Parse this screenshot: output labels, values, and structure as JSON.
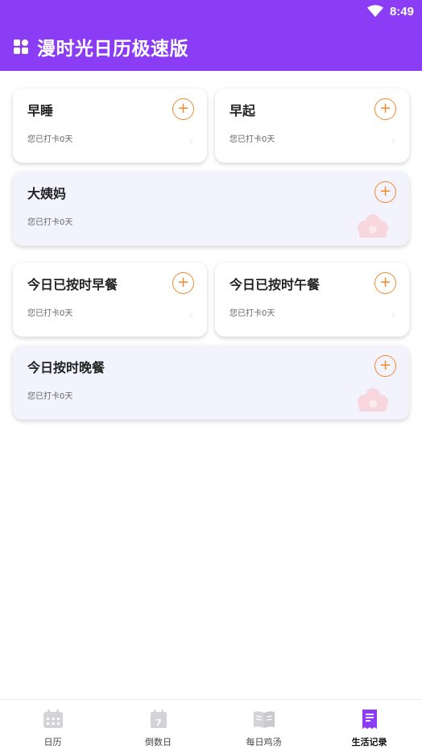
{
  "status": {
    "time": "8:49"
  },
  "app": {
    "title": "漫时光日历极速版"
  },
  "cards": [
    {
      "title": "早睡",
      "sub": "您已打卡0天",
      "add": "+"
    },
    {
      "title": "早起",
      "sub": "您已打卡0天",
      "add": "+"
    },
    {
      "title": "大姨妈",
      "sub": "您已打卡0天",
      "add": "+"
    },
    {
      "title": "今日已按时早餐",
      "sub": "您已打卡0天",
      "add": "+"
    },
    {
      "title": "今日已按时午餐",
      "sub": "您已打卡0天",
      "add": "+"
    },
    {
      "title": "今日按时晚餐",
      "sub": "您已打卡0天",
      "add": "+"
    }
  ],
  "nav": [
    {
      "label": "日历",
      "icon": "calendar-icon"
    },
    {
      "label": "倒数日",
      "icon": "countdown-calendar-icon",
      "badge": "7"
    },
    {
      "label": "每日鸡汤",
      "icon": "open-book-icon"
    },
    {
      "label": "生活记录",
      "icon": "record-note-icon"
    }
  ],
  "colors": {
    "brand": "#8b3df5",
    "accent": "#f08a2c",
    "wide_card_bg": "#f3f3fd"
  }
}
